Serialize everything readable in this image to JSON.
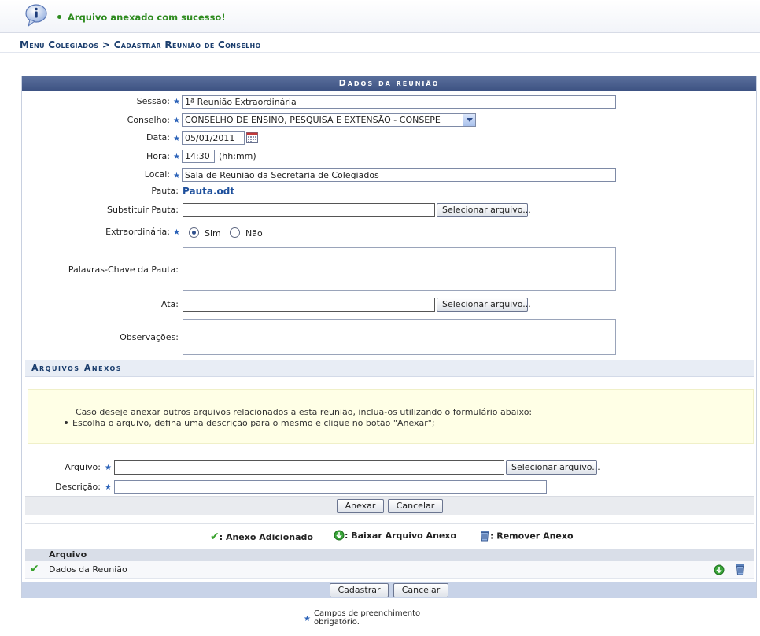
{
  "message": {
    "text": "Arquivo anexado com sucesso!"
  },
  "breadcrumb": "Menu Colegiados > Cadastrar Reunião de Conselho",
  "panel": {
    "title": "Dados da reunião"
  },
  "form": {
    "sessao": {
      "label": "Sessão:",
      "value": "1ª Reunião Extraordinária"
    },
    "conselho": {
      "label": "Conselho:",
      "value": "CONSELHO DE ENSINO, PESQUISA E EXTENSÃO - CONSEPE"
    },
    "data": {
      "label": "Data:",
      "value": "05/01/2011"
    },
    "hora": {
      "label": "Hora:",
      "value": "14:30",
      "hint": "(hh:mm)"
    },
    "local": {
      "label": "Local:",
      "value": "Sala de Reunião da Secretaria de Colegiados"
    },
    "pauta": {
      "label": "Pauta:",
      "link": "Pauta.odt"
    },
    "substituir_pauta": {
      "label": "Substituir Pauta:",
      "button": "Selecionar arquivo..."
    },
    "extraordinaria": {
      "label": "Extraordinária:",
      "options": [
        "Sim",
        "Não"
      ],
      "selected": "Sim"
    },
    "palavras_chave": {
      "label": "Palavras-Chave da Pauta:"
    },
    "ata": {
      "label": "Ata:",
      "button": "Selecionar arquivo..."
    },
    "observacoes": {
      "label": "Observações:"
    }
  },
  "anexos": {
    "title": "Arquivos Anexos",
    "info_line1": "Caso deseje anexar outros arquivos relacionados a esta reunião, inclua-os utilizando o formulário abaixo:",
    "info_line2": "Escolha o arquivo, defina uma descrição para o mesmo e clique no botão \"Anexar\";",
    "arquivo_label": "Arquivo:",
    "arquivo_button": "Selecionar arquivo...",
    "descricao_label": "Descrição:",
    "anexar_button": "Anexar",
    "cancelar_button": "Cancelar",
    "legend": {
      "added": ": Anexo Adicionado",
      "download": ": Baixar Arquivo Anexo",
      "remove": ": Remover Anexo"
    },
    "table_header": "Arquivo",
    "rows": [
      {
        "name": "Dados da Reunião"
      }
    ]
  },
  "footer": {
    "cadastrar_button": "Cadastrar",
    "cancelar_button": "Cancelar",
    "required_note_line1": "Campos de preenchimento",
    "required_note_line2": "obrigatório."
  },
  "colors": {
    "header": "#3e5383",
    "success": "#2e8b1f",
    "breadcrumb": "#1a3d6d"
  }
}
